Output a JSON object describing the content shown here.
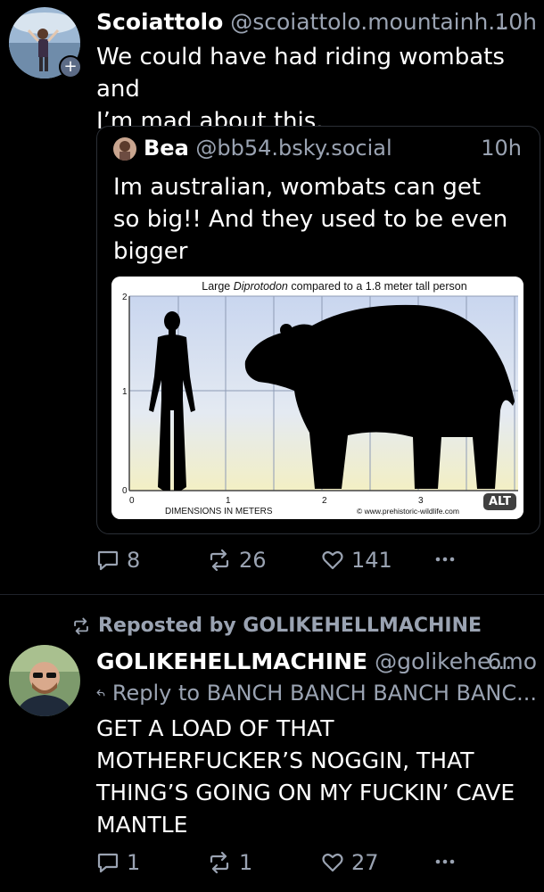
{
  "post1": {
    "author_name": "Scoiattolo",
    "author_handle": "@scoiattolo.mountainh...",
    "time": "10h",
    "text_line1": "We could have had riding wombats and",
    "text_line2": "I’m mad about this.",
    "quote": {
      "author_name": "Bea",
      "author_handle": "@bb54.bsky.social",
      "time": "10h",
      "text_line1": "Im australian, wombats can get",
      "text_line2": "so big!! And they used to be even",
      "text_line3": "bigger",
      "image": {
        "title_prefix": "Large ",
        "title_italic": "Diprotodon",
        "title_suffix": " compared to a 1.8 meter tall person",
        "x_axis_label": "DIMENSIONS IN METERS",
        "credit": "© www.prehistoric-wildlife.com",
        "x_ticks": [
          "0",
          "1",
          "2",
          "3"
        ],
        "y_ticks": [
          "0",
          "1",
          "2"
        ],
        "alt_badge": "ALT"
      }
    },
    "replies": "8",
    "reposts": "26",
    "likes": "141"
  },
  "post2": {
    "repost_label": "Reposted by GOLIKEHELLMACHINE",
    "author_name": "GOLIKEHELLMACHINE",
    "author_handle": "@golikehe...",
    "time": "6mo",
    "reply_to": "Reply to BANCH BANCH BANCH BANC...",
    "text_line1": "GET A LOAD OF THAT",
    "text_line2": "MOTHERFUCKER’S NOGGIN, THAT",
    "text_line3": "THING’S GOING ON MY FUCKIN’ CAVE",
    "text_line4": "MANTLE",
    "replies": "1",
    "reposts": "1",
    "likes": "27"
  },
  "icons": {
    "reply": "speech-bubble-icon",
    "repost": "repost-arrows-icon",
    "like": "heart-icon",
    "more": "ellipsis-icon"
  },
  "colors": {
    "background": "#000000",
    "muted": "#9aa3b2",
    "divider": "#1f232a"
  }
}
